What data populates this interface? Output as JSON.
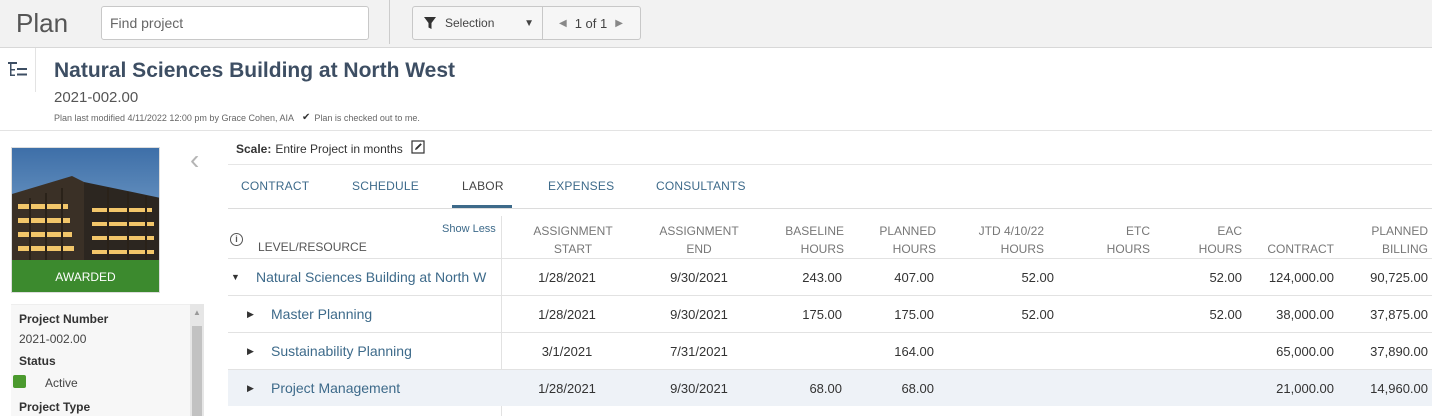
{
  "app": {
    "title": "Plan"
  },
  "search": {
    "placeholder": "Find project"
  },
  "selector": {
    "label": "Selection",
    "pager": "1 of 1"
  },
  "project": {
    "name": "Natural Sciences Building at North West",
    "number": "2021-002.00",
    "modified": "Plan last modified 4/11/2022 12:00 pm by Grace Cohen, AIA",
    "checkout": "Plan is checked out to me."
  },
  "left": {
    "badge": "AWARDED",
    "fields": [
      {
        "label": "Project Number",
        "value": "2021-002.00"
      },
      {
        "label": "Status",
        "value": "Active"
      },
      {
        "label": "Project Type",
        "value": ""
      }
    ]
  },
  "scale": {
    "label": "Scale:",
    "value": "Entire Project in months"
  },
  "tabs": [
    "CONTRACT",
    "SCHEDULE",
    "LABOR",
    "EXPENSES",
    "CONSULTANTS"
  ],
  "active_tab": "LABOR",
  "grid": {
    "show_less": "Show Less",
    "first_col": "LEVEL/RESOURCE",
    "columns": [
      {
        "line1": "ASSIGNMENT",
        "line2": "START"
      },
      {
        "line1": "ASSIGNMENT",
        "line2": "END"
      },
      {
        "line1": "BASELINE",
        "line2": "HOURS"
      },
      {
        "line1": "PLANNED",
        "line2": "HOURS"
      },
      {
        "line1": "JTD 4/10/22",
        "line2": "HOURS"
      },
      {
        "line1": "ETC",
        "line2": "HOURS"
      },
      {
        "line1": "EAC",
        "line2": "HOURS"
      },
      {
        "line1": "",
        "line2": "CONTRACT"
      },
      {
        "line1": "PLANNED",
        "line2": "BILLING"
      }
    ],
    "rows": [
      {
        "name": "Natural Sciences Building at North W",
        "expanded": true,
        "values": [
          "1/28/2021",
          "9/30/2021",
          "243.00",
          "407.00",
          "52.00",
          "",
          "52.00",
          "124,000.00",
          "90,725.00"
        ]
      },
      {
        "name": "Master Planning",
        "expanded": false,
        "values": [
          "1/28/2021",
          "9/30/2021",
          "175.00",
          "175.00",
          "52.00",
          "",
          "52.00",
          "38,000.00",
          "37,875.00"
        ]
      },
      {
        "name": "Sustainability Planning",
        "expanded": false,
        "values": [
          "3/1/2021",
          "7/31/2021",
          "",
          "164.00",
          "",
          "",
          "",
          "65,000.00",
          "37,890.00"
        ]
      },
      {
        "name": "Project Management",
        "expanded": false,
        "values": [
          "1/28/2021",
          "9/30/2021",
          "68.00",
          "68.00",
          "",
          "",
          "",
          "21,000.00",
          "14,960.00"
        ]
      }
    ]
  }
}
